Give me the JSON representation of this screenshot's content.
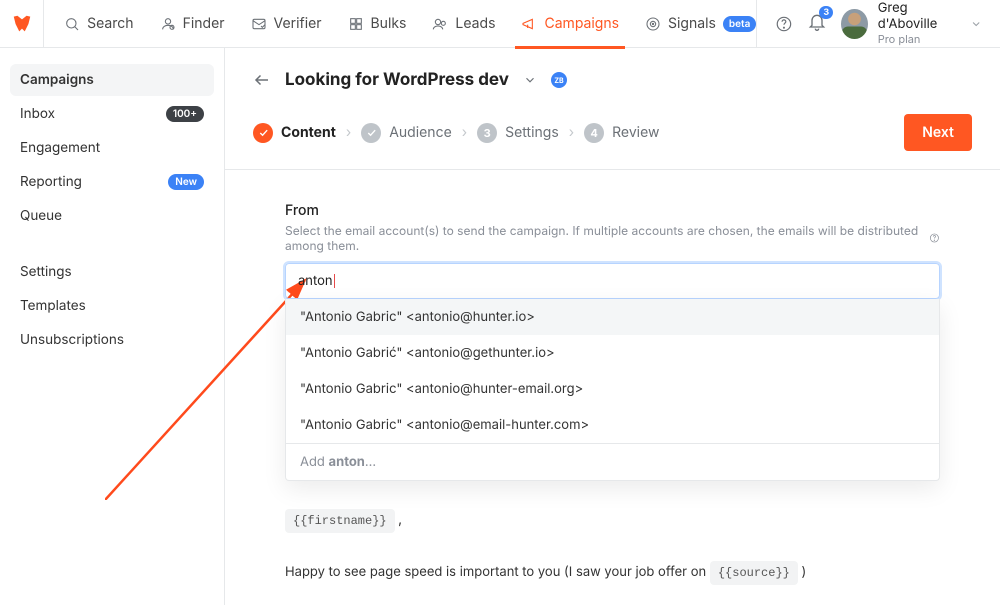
{
  "topnav": [
    {
      "label": "Search"
    },
    {
      "label": "Finder"
    },
    {
      "label": "Verifier"
    },
    {
      "label": "Bulks"
    },
    {
      "label": "Leads"
    },
    {
      "label": "Campaigns",
      "active": true
    },
    {
      "label": "Signals",
      "beta": "beta"
    }
  ],
  "notifications": {
    "count": "3"
  },
  "user": {
    "name": "Greg d'Aboville",
    "plan": "Pro plan"
  },
  "sidebar": [
    {
      "label": "Campaigns",
      "active": true
    },
    {
      "label": "Inbox",
      "pill": "100+"
    },
    {
      "label": "Engagement"
    },
    {
      "label": "Reporting",
      "pill": "New",
      "pill_blue": true
    },
    {
      "label": "Queue"
    }
  ],
  "sidebar2": [
    {
      "label": "Settings"
    },
    {
      "label": "Templates"
    },
    {
      "label": "Unsubscriptions"
    }
  ],
  "page": {
    "title": "Looking for WordPress dev",
    "zb": "ZB",
    "next": "Next"
  },
  "steps": [
    {
      "label": "Content",
      "active": true,
      "check": true
    },
    {
      "label": "Audience"
    },
    {
      "num": "3",
      "label": "Settings"
    },
    {
      "num": "4",
      "label": "Review"
    }
  ],
  "from": {
    "label": "From",
    "help": "Select the email account(s) to send the campaign. If multiple accounts are chosen, the emails will be distributed among them.",
    "typed": "anton",
    "options": [
      "\"Antonio Gabric\" <antonio@hunter.io>",
      "\"Antonio Gabrić\" <antonio@gethunter.io>",
      "\"Antonio Gabric\" <antonio@hunter-email.org>",
      "\"Antonio Gabric\" <antonio@email-hunter.com>"
    ],
    "add_prefix": "Add ",
    "add_value": "anton",
    "add_suffix": "..."
  },
  "editor": {
    "chip1": "{{firstname}}",
    "comma": " ,",
    "line": "Happy to see page speed is important to you (I saw your job offer on ",
    "chip2": "{{source}}",
    "close": " )"
  }
}
